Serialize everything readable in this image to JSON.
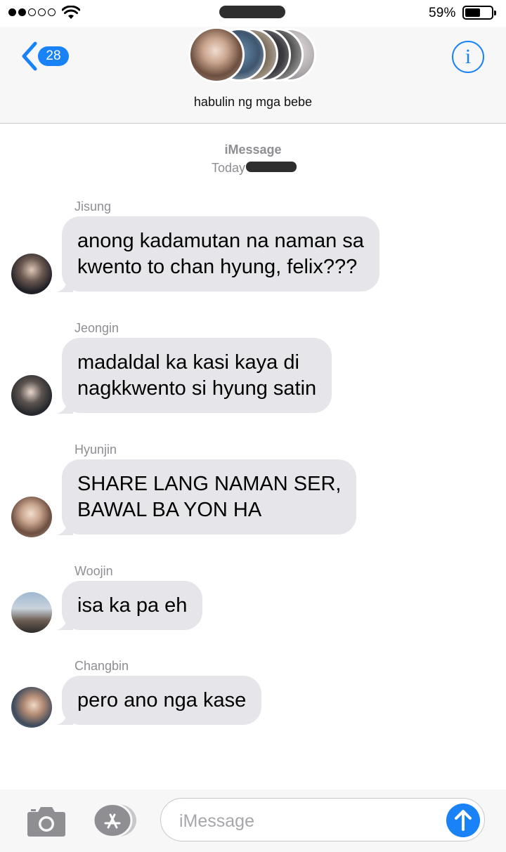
{
  "status_bar": {
    "signal_bars_filled": 2,
    "signal_bars_total": 5,
    "battery_percent": "59%",
    "battery_level": 0.59
  },
  "header": {
    "back_count": "28",
    "group_name": "habulin ng mga bebe",
    "info_label": "i"
  },
  "thread": {
    "service": "iMessage",
    "time": "Today"
  },
  "messages": [
    {
      "sender": "Jisung",
      "text_lines": [
        "anong kadamutan na naman sa",
        "kwento to chan hyung, felix???"
      ]
    },
    {
      "sender": "Jeongin",
      "text_lines": [
        "madaldal ka kasi kaya di",
        "nagkkwento si hyung satin"
      ]
    },
    {
      "sender": "Hyunjin",
      "text_lines": [
        "SHARE LANG NAMAN SER,",
        "BAWAL BA YON HA"
      ]
    },
    {
      "sender": "Woojin",
      "text_lines": [
        "isa ka pa eh"
      ]
    },
    {
      "sender": "Changbin",
      "text_lines": [
        "pero ano nga kase"
      ]
    }
  ],
  "composer": {
    "placeholder": "iMessage"
  },
  "colors": {
    "accent": "#1a82f7",
    "bubble_incoming": "#e5e5ea",
    "meta_text": "#8e8e93"
  },
  "icons": [
    "back-chevron-icon",
    "info-icon",
    "camera-icon",
    "app-store-icon",
    "send-arrow-icon",
    "wifi-icon",
    "battery-icon"
  ]
}
